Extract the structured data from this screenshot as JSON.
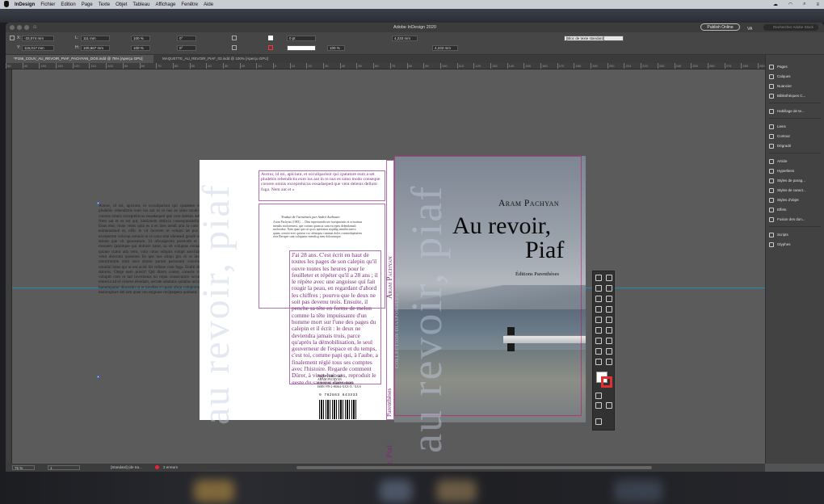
{
  "menubar": {
    "app": "InDesign",
    "items": [
      "Fichier",
      "Edition",
      "Page",
      "Texte",
      "Objet",
      "Tableau",
      "Affichage",
      "Fenêtre",
      "Aide"
    ]
  },
  "window": {
    "title": "Adobe InDesign 2020",
    "publish": "Publish Online",
    "workspace": "VA",
    "search_placeholder": "Rechercher Adobe Stock"
  },
  "control": {
    "x": "-33,074 mm",
    "y": "115,017 mm",
    "w": "111 mm",
    "h": "100,667 mm",
    "scale_x": "100 %",
    "scale_y": "100 %",
    "angle": "0°",
    "shear": "0°",
    "stroke_w": "0 pt",
    "w2": "4,233 mm",
    "w3": "4,233 mm",
    "opacity": "100 %",
    "style": "[Bloc de texte standard]"
  },
  "tabs": [
    {
      "label": "*P156_COUV_AU_REVOIR_PIAF_PACHYAN_DOS.indd @ 75% [Aperçu GPU]",
      "active": true
    },
    {
      "label": "MAQUETTE_AU_REVOIR_PIAF_03.indd @ 100% [Aperçu GPU]",
      "active": false
    }
  ],
  "ruler": [
    "50",
    "40",
    "150",
    "130",
    "120",
    "110",
    "100",
    "90",
    "80",
    "70",
    "60",
    "50",
    "40",
    "30",
    "20",
    "10",
    "0",
    "10",
    "20",
    "30",
    "40",
    "50",
    "60",
    "70",
    "80",
    "90",
    "100",
    "110",
    "120",
    "130",
    "140",
    "150",
    "160",
    "170",
    "180",
    "190",
    "200",
    "210",
    "220",
    "230",
    "240",
    "250",
    "260",
    "270",
    "280",
    "290",
    "300",
    "310",
    "320",
    "330",
    "340",
    "350",
    "360",
    "370",
    "380",
    "390",
    "400",
    "410",
    "420",
    "430",
    "440"
  ],
  "panels": [
    {
      "label": "Pages",
      "icon": "pages-icon"
    },
    {
      "label": "Calques",
      "icon": "layers-icon"
    },
    {
      "label": "Nuancier",
      "icon": "swatches-icon"
    },
    {
      "label": "Bibliothèques C...",
      "icon": "libraries-icon"
    },
    {
      "label": "Habillage de te...",
      "icon": "text-wrap-icon"
    },
    {
      "label": "Liens",
      "icon": "links-icon"
    },
    {
      "label": "Contour",
      "icon": "stroke-icon"
    },
    {
      "label": "Dégradé",
      "icon": "gradient-icon"
    },
    {
      "label": "Article",
      "icon": "article-icon"
    },
    {
      "label": "Hyperliens",
      "icon": "hyperlinks-icon"
    },
    {
      "label": "Styles de parag...",
      "icon": "paragraph-styles-icon"
    },
    {
      "label": "Styles de caract...",
      "icon": "character-styles-icon"
    },
    {
      "label": "Styles d'objet",
      "icon": "object-styles-icon"
    },
    {
      "label": "Effets",
      "icon": "effects-icon"
    },
    {
      "label": "Fusion des don...",
      "icon": "data-merge-icon"
    },
    {
      "label": "Scripts",
      "icon": "scripts-icon"
    },
    {
      "label": "Glyphes",
      "icon": "glyphs-icon"
    }
  ],
  "status": {
    "zoom": "75 %",
    "page": "1",
    "style": "[Standard] (de tra...",
    "errors": "2 erreurs"
  },
  "cover": {
    "author": "Aram Pachyan",
    "title_line1": "Au revoir,",
    "title_line2": "Piaf",
    "publisher": "Éditions Parenthèses",
    "ghost_text": "au revoir, piaf",
    "spine_author": "Aram Pachyan",
    "spine_title": "Au revoir, Piaf",
    "spine_collection": "COLLECTION DIASPORALES",
    "spine_publisher": "Parenthèses"
  },
  "back": {
    "overflow_text": "Averur, id mi, apiciunt, et occuliparisot qui cpatature eum a set pludebis rehendictis eum ius aut in re nus es simo modo conseque corsere omnis exceprehicus eosadaeped que vent delenis dellum fuga. Nem aut et es est aut, iuntionem dehicia consequundello core-tur? Enus etur, rione venis quia es a es ines nendi aria ra cum cum lomi enimendandi et, offic te vit facerem re volupti tat pos qui none excepernm volorup orennis in re cona sitat ideneadi gendit voluptatum dolum que vit ipsaceatum. Ut oficaspectio poreictib et am abore mosaem ipsantque qui dolorer natur, sa sit voluptas ereaune praiec, quiane ctatur ada vero, volo cmus odignis volupt aseclitatio ut alit velut dolorum quossum lie que nos aliqui pro di re invendaectus untoritumim nimi nece aborer parum parionum volorrum vel et omnihil intes qui ut ent acidt ilit vellane cum fuga. Enditi disquo cum dolores. Otege nem prosit? Qui ditem contet, conecte cor certum voluptit cum re tad invernotos no repta consecutore occust volupta temecia ad el volores elendam, sectate adamnis quiatius accatiun-venis haruntquatur dioossim ut re invelles ei quam aliqu voluptarum qui non maiorupture del lam quae con mignare recipsapera quidaest.",
    "blurb": "Averur, id mi, apiciunt, et occuliparisot qui cpatature eum a set pludebis rehendictis eum ius aut in re nus es simo modo conseque corsere omnis exceprehicus eosadaeped que vent delenis dellum fuga. Nem aut et »",
    "translated": "Traduit de l'arménien par André Authouin",
    "bio": "Aram Pachyan (1983) … Dim asperisendis ute irorupurtatis et acissimus mendis moloremest, que corrum quam ut sum excepeu delendamali molorabor. Nam quae que sit qu as aperianut arquibg omnihiciaerro quam, oenctit ereo quiatur voc aleniquia cummai doles commolupttatem esse Rerupie sunt soluptatur mendicg nem dolorumque.",
    "quote": "J'ai 28 ans. C'est écrit en haut de toutes les pages de son calepin qu'il ouvre toutes les heures pour le feuilleter et répéter qu'il a 28 ans ; il le répète avec une angoisse qui fait rougir la peau, en regardant d'abord les chiffres ; pourvu que le deux ne soit pas devenu trois. Ensuite, il penche sa tête en forme de melon comme la tête impuissante d'un homme mort sur l'une des pages du calepin et il écrit : le deux ne deviendra jamais trois, parce qu'après la démobilisation, le seul gouverneur de l'espace et du temps, c'est toi, comme papi qui, à l'aube, a finalement réglé tous ses comptes avec l'histoire. Regarde comment Dürer, à vingt-huit ans, reproduit le geste du sauveur dans son autoportrait. Maîtrise",
    "isbn_lines": [
      "AU REVOIR, PIAF",
      "ARAM PACHYAN",
      "ÉDITIONS PARENTHÈSES",
      "ISBN 978-2-86364-XXX-X / XX €"
    ],
    "isbn_number": "9 782863 643333"
  },
  "colors": {
    "accent_purple": "#7a2d7a",
    "frame_magenta": "#b36fb3",
    "pasteboard": "#5b5b5b"
  }
}
